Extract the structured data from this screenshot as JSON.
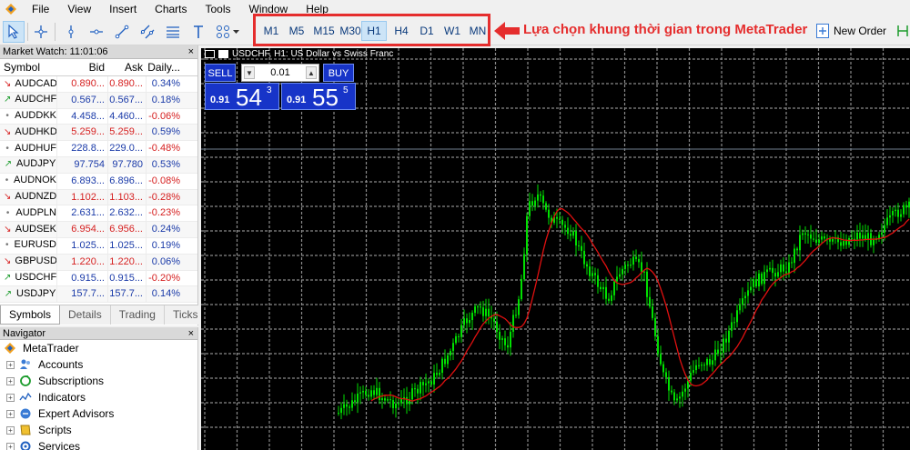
{
  "menu": {
    "items": [
      "File",
      "View",
      "Insert",
      "Charts",
      "Tools",
      "Window",
      "Help"
    ]
  },
  "toolbar": {
    "timeframes": [
      "M1",
      "M5",
      "M15",
      "M30",
      "H1",
      "H4",
      "D1",
      "W1",
      "MN"
    ],
    "active_timeframe": "H1",
    "annotation": "Lựa chọn khung thời gian trong MetaTrader",
    "new_order_label": "New Order",
    "annotation_color": "#e52d2d"
  },
  "market_watch": {
    "title": "Market Watch: 11:01:06",
    "columns": [
      "Symbol",
      "Bid",
      "Ask",
      "Daily..."
    ],
    "rows": [
      {
        "symbol": "AUDCAD",
        "dir": "down",
        "bid": "0.890...",
        "ask": "0.890...",
        "daily": "0.34%"
      },
      {
        "symbol": "AUDCHF",
        "dir": "up",
        "bid": "0.567...",
        "ask": "0.567...",
        "daily": "0.18%"
      },
      {
        "symbol": "AUDDKK",
        "dir": "flat",
        "bid": "4.458...",
        "ask": "4.460...",
        "daily": "-0.06%"
      },
      {
        "symbol": "AUDHKD",
        "dir": "down",
        "bid": "5.259...",
        "ask": "5.259...",
        "daily": "0.59%"
      },
      {
        "symbol": "AUDHUF",
        "dir": "flat",
        "bid": "228.8...",
        "ask": "229.0...",
        "daily": "-0.48%"
      },
      {
        "symbol": "AUDJPY",
        "dir": "up",
        "bid": "97.754",
        "ask": "97.780",
        "daily": "0.53%"
      },
      {
        "symbol": "AUDNOK",
        "dir": "flat",
        "bid": "6.893...",
        "ask": "6.896...",
        "daily": "-0.08%"
      },
      {
        "symbol": "AUDNZD",
        "dir": "down",
        "bid": "1.102...",
        "ask": "1.103...",
        "daily": "-0.28%"
      },
      {
        "symbol": "AUDPLN",
        "dir": "flat",
        "bid": "2.631...",
        "ask": "2.632...",
        "daily": "-0.23%"
      },
      {
        "symbol": "AUDSEK",
        "dir": "down",
        "bid": "6.954...",
        "ask": "6.956...",
        "daily": "0.24%"
      },
      {
        "symbol": "EURUSD",
        "dir": "flat",
        "bid": "1.025...",
        "ask": "1.025...",
        "daily": "0.19%"
      },
      {
        "symbol": "GBPUSD",
        "dir": "down",
        "bid": "1.220...",
        "ask": "1.220...",
        "daily": "0.06%"
      },
      {
        "symbol": "USDCHF",
        "dir": "up",
        "bid": "0.915...",
        "ask": "0.915...",
        "daily": "-0.20%"
      },
      {
        "symbol": "USDJPY",
        "dir": "up",
        "bid": "157.7...",
        "ask": "157.7...",
        "daily": "0.14%"
      }
    ],
    "tabs": [
      "Symbols",
      "Details",
      "Trading",
      "Ticks"
    ],
    "active_tab": "Symbols"
  },
  "navigator": {
    "title": "Navigator",
    "root": "MetaTrader",
    "items": [
      {
        "label": "Accounts",
        "icon": "accounts-icon"
      },
      {
        "label": "Subscriptions",
        "icon": "subscriptions-icon"
      },
      {
        "label": "Indicators",
        "icon": "indicators-icon"
      },
      {
        "label": "Expert Advisors",
        "icon": "expert-advisors-icon"
      },
      {
        "label": "Scripts",
        "icon": "scripts-icon"
      },
      {
        "label": "Services",
        "icon": "services-icon"
      }
    ]
  },
  "chart": {
    "title": "USDCHF, H1:  US Dollar vs Swiss Franc",
    "sell_label": "SELL",
    "buy_label": "BUY",
    "lot": "0.01",
    "sell_price": {
      "prefix": "0.91",
      "big": "54",
      "sup": "3"
    },
    "buy_price": {
      "prefix": "0.91",
      "big": "55",
      "sup": "5"
    },
    "candle_color": "#00e000",
    "ma_color": "#e01010",
    "grid_color": "#8a8a8a"
  }
}
